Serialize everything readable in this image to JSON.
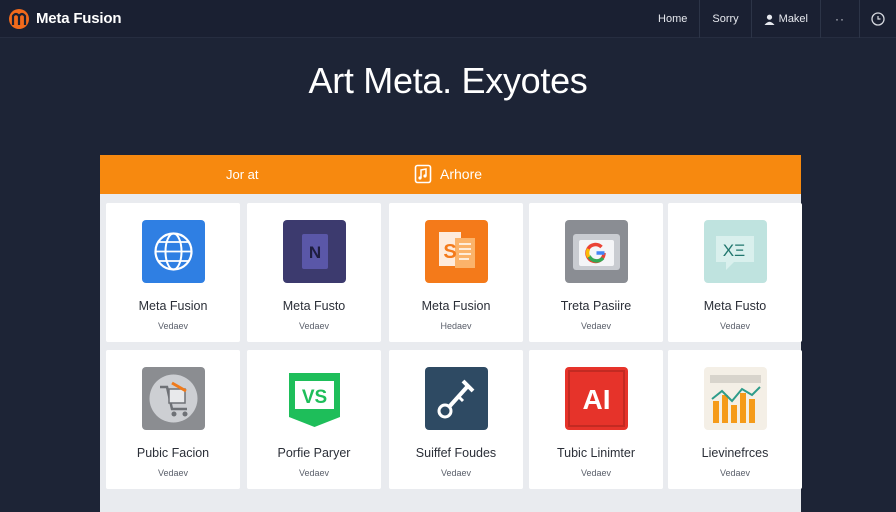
{
  "navbar": {
    "brand": "Meta Fusion",
    "links": [
      "Home",
      "Sorry"
    ],
    "user_label": "Makel",
    "more": "··"
  },
  "hero": {
    "title": "Art Meta. Exyotes"
  },
  "bar": {
    "left_label": "Jor at",
    "center_label": "Arhore"
  },
  "cards": [
    {
      "title": "Meta Fusion",
      "sub": "Vedaev",
      "icon": "globe-icon"
    },
    {
      "title": "Meta Fusto",
      "sub": "Vedaev",
      "icon": "n-icon"
    },
    {
      "title": "Meta Fusion",
      "sub": "Hedaev",
      "icon": "s-doc-icon"
    },
    {
      "title": "Treta Pasiire",
      "sub": "Vedaev",
      "icon": "google-icon"
    },
    {
      "title": "Meta Fusto",
      "sub": "Vedaev",
      "icon": "xe-chat-icon"
    },
    {
      "title": "Pubic Facion",
      "sub": "Vedaev",
      "icon": "cart-icon"
    },
    {
      "title": "Porfie Paryer",
      "sub": "Vedaev",
      "icon": "vs-icon"
    },
    {
      "title": "Suiffef Foudes",
      "sub": "Vedaev",
      "icon": "key-icon"
    },
    {
      "title": "Tubic Linimter",
      "sub": "Vedaev",
      "icon": "ai-icon"
    },
    {
      "title": "Lievinefrces",
      "sub": "Vedaev",
      "icon": "chart-icon"
    }
  ],
  "colors": {
    "background": "#1d2436",
    "accent": "#f7890f",
    "panel": "#e9ebef"
  }
}
